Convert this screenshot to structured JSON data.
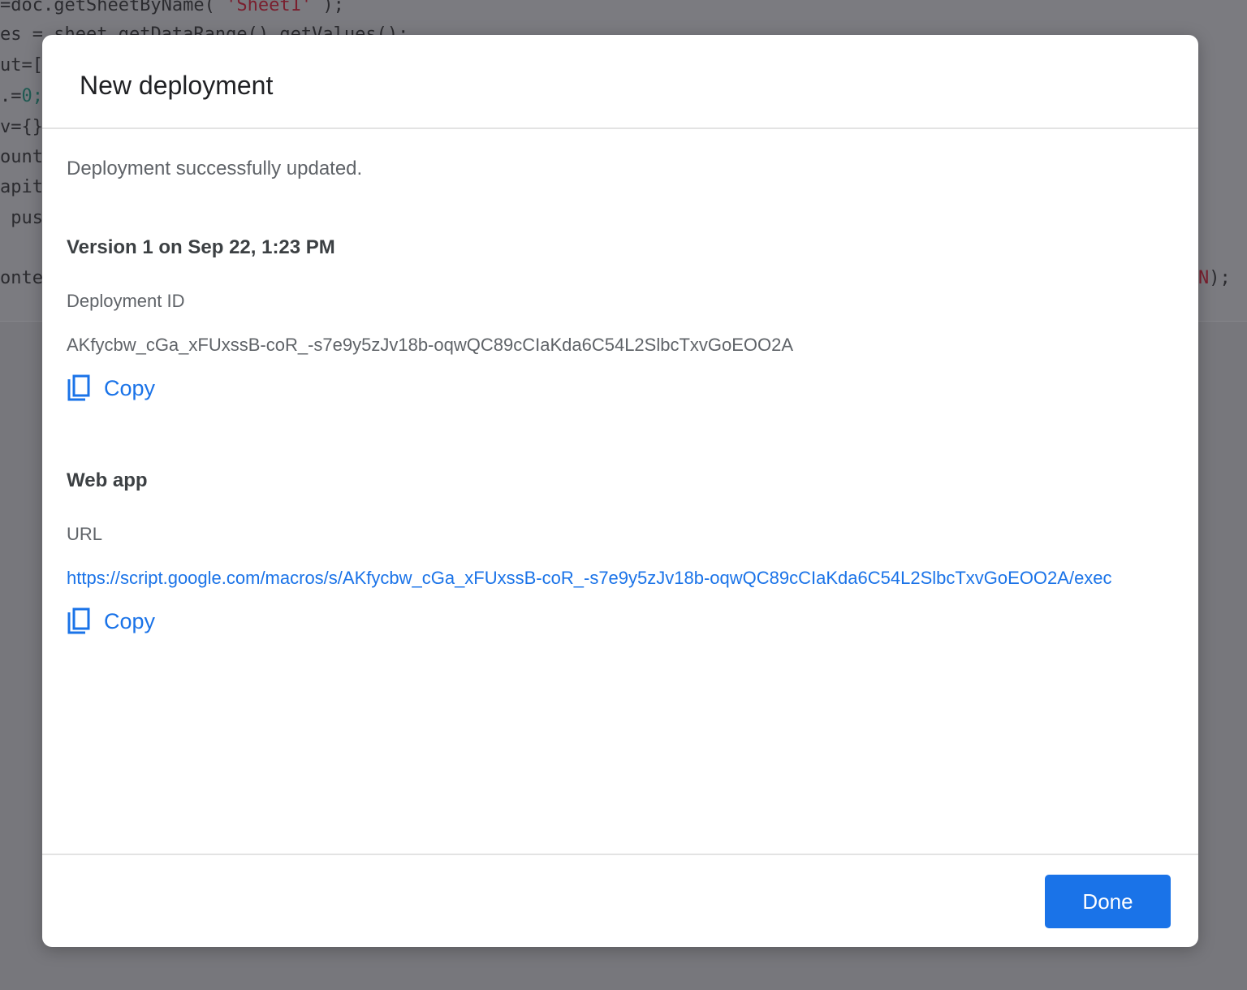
{
  "background_code": {
    "lines": [
      {
        "text": "=doc.getSheetByName(",
        "str": "'Sheet1'",
        "end": ");"
      },
      {
        "text": "es = ",
        "str": "",
        "end": "sheet.getDataRange().getValues();"
      },
      {
        "text": "ut=[",
        "str": "",
        "end": ""
      },
      {
        "text": ".=",
        "str": "",
        "end": "",
        "num": "0;"
      },
      {
        "text": "v={}",
        "str": "",
        "end": ""
      },
      {
        "text": "",
        "str": "ount",
        "end": ""
      },
      {
        "text": "",
        "str": "apit",
        "end": ""
      },
      {
        "text": " pus",
        "str": "",
        "end": ""
      },
      {
        "text": "",
        "str": "onte",
        "end": ""
      }
    ],
    "right_fragment_str": "N",
    "right_fragment_end": ");"
  },
  "dialog": {
    "title": "New deployment",
    "status": "Deployment successfully updated.",
    "version": "Version 1 on Sep 22, 1:23 PM",
    "deployment_id_label": "Deployment ID",
    "deployment_id": "AKfycbw_cGa_xFUxssB-coR_-s7e9y5zJv18b-oqwQC89cCIaKda6C54L2SlbcTxvGoEOO2A",
    "copy_label": "Copy",
    "web_app_heading": "Web app",
    "url_label": "URL",
    "url": "https://script.google.com/macros/s/AKfycbw_cGa_xFUxssB-coR_-s7e9y5zJv18b-oqwQC89cCIaKda6C54L2SlbcTxvGoEOO2A/exec",
    "done_label": "Done"
  },
  "colors": {
    "accent": "#1a73e8",
    "overlay": "#77777c"
  }
}
